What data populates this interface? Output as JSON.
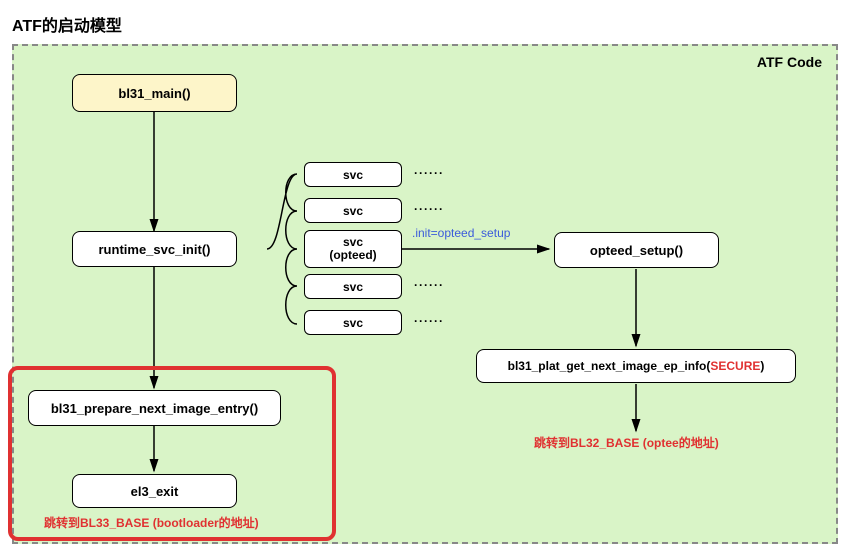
{
  "title": "ATF的启动模型",
  "container_label": "ATF Code",
  "nodes": {
    "bl31_main": "bl31_main()",
    "runtime_svc_init": "runtime_svc_init()",
    "bl31_prepare": "bl31_prepare_next_image_entry()",
    "el3_exit": "el3_exit",
    "opteed_setup": "opteed_setup()",
    "bl31_plat_get_prefix": "bl31_plat_get_next_image_ep_info(",
    "bl31_plat_get_arg": "SECURE",
    "bl31_plat_get_suffix": ")"
  },
  "svc": {
    "svc1": "svc",
    "svc2": "svc",
    "svc3_line1": "svc",
    "svc3_line2": "(opteed)",
    "svc4": "svc",
    "svc5": "svc",
    "dots": "······"
  },
  "edge_labels": {
    "init_opteed": ".init=opteed_setup"
  },
  "red_labels": {
    "bl33": "跳转到BL33_BASE (bootloader的地址)",
    "bl32": "跳转到BL32_BASE (optee的地址)"
  }
}
